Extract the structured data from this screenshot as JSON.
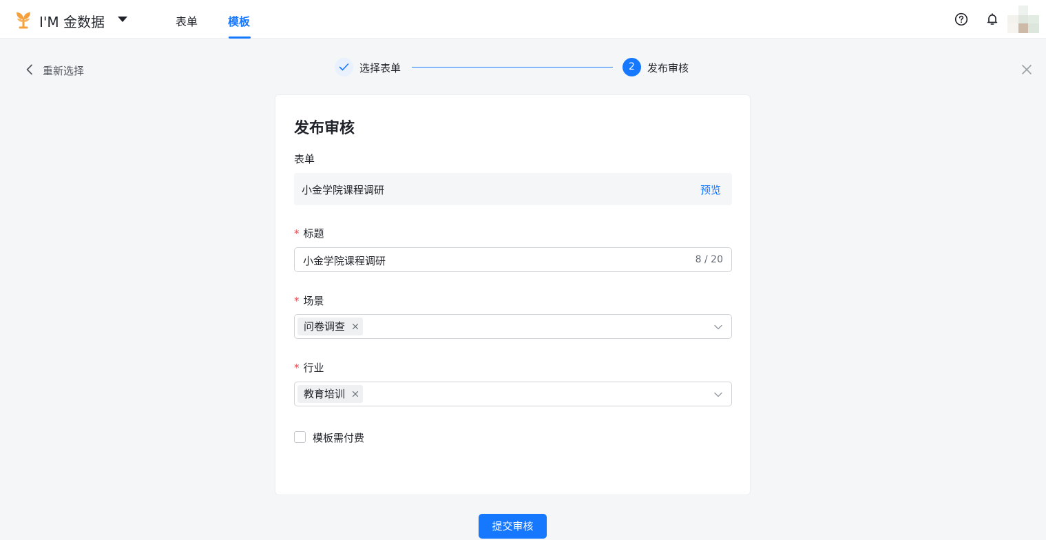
{
  "header": {
    "app_name": "I'M 金数据",
    "tabs": [
      {
        "label": "表单",
        "active": false
      },
      {
        "label": "模板",
        "active": true
      }
    ],
    "icons": [
      "help-icon",
      "bell-icon"
    ],
    "accent_color": "#1677ff",
    "logo_color": "#f5a03a"
  },
  "subbar": {
    "back_label": "重新选择",
    "steps": [
      {
        "label": "选择表单",
        "status": "done"
      },
      {
        "number": "2",
        "label": "发布审核",
        "status": "current"
      }
    ]
  },
  "card": {
    "title": "发布审核",
    "form_label": "表单",
    "form_name": "小金学院课程调研",
    "preview_label": "预览",
    "title_field": {
      "label": "标题",
      "required_mark": "*",
      "value": "小金学院课程调研",
      "counter": "8 / 20"
    },
    "scene_field": {
      "label": "场景",
      "required_mark": "*",
      "tag": "问卷调查"
    },
    "industry_field": {
      "label": "行业",
      "required_mark": "*",
      "tag": "教育培训"
    },
    "paid_checkbox": {
      "label": "模板需付费",
      "checked": false
    }
  },
  "submit_label": "提交审核"
}
